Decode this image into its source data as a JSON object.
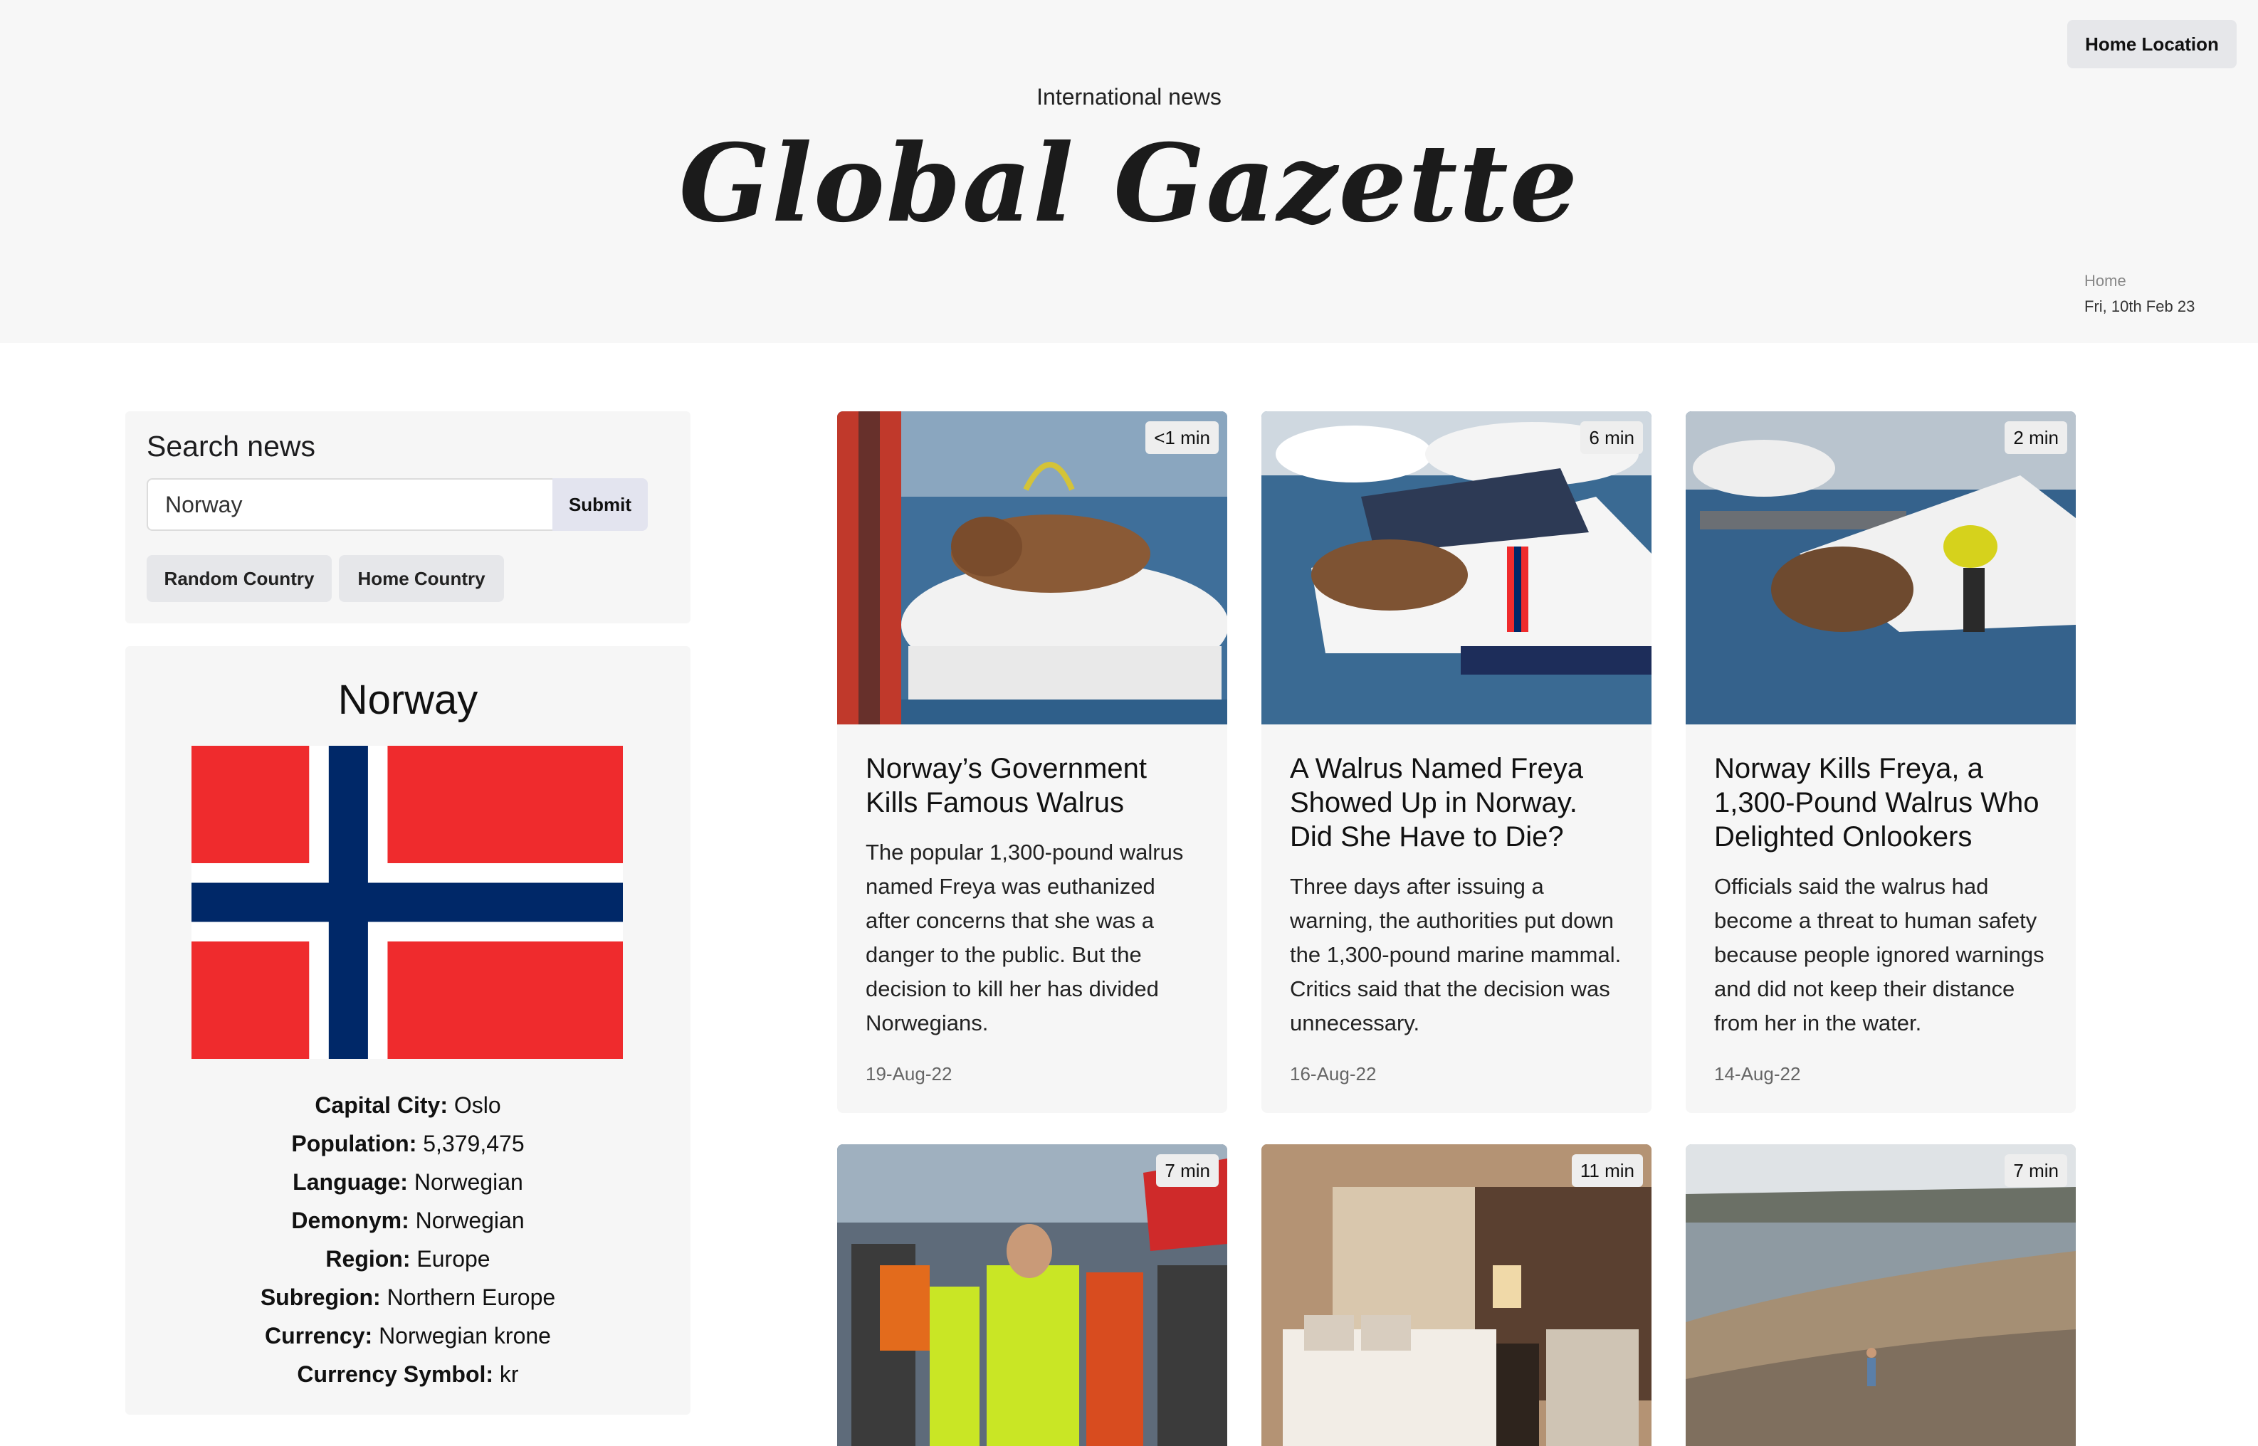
{
  "header": {
    "home_location_button": "Home Location",
    "kicker": "International news",
    "masthead": "Global Gazette",
    "breadcrumb": "Home",
    "date": "Fri, 10th Feb 23"
  },
  "search": {
    "title": "Search news",
    "input_value": "Norway",
    "submit_label": "Submit",
    "random_country_label": "Random Country",
    "home_country_label": "Home Country"
  },
  "country": {
    "name": "Norway",
    "flag_colors": {
      "red": "#ef2b2d",
      "blue": "#002868",
      "white": "#ffffff"
    },
    "facts": [
      {
        "label": "Capital City:",
        "value": "Oslo"
      },
      {
        "label": "Population:",
        "value": "5,379,475"
      },
      {
        "label": "Language:",
        "value": "Norwegian"
      },
      {
        "label": "Demonym:",
        "value": "Norwegian"
      },
      {
        "label": "Region:",
        "value": "Europe"
      },
      {
        "label": "Subregion:",
        "value": "Northern Europe"
      },
      {
        "label": "Currency:",
        "value": "Norwegian krone"
      },
      {
        "label": "Currency Symbol:",
        "value": "kr"
      }
    ]
  },
  "articles": [
    {
      "read_time": "<1 min",
      "title": "Norway’s Government Kills Famous Walrus",
      "description": "The popular 1,300-pound walrus named Freya was euthanized after concerns that she was a danger to the public. But the decision to kill her has divided Norwegians.",
      "date": "19-Aug-22",
      "image": "walrus-on-boat-photo"
    },
    {
      "read_time": "6 min",
      "title": "A Walrus Named Freya Showed Up in Norway. Did She Have to Die?",
      "description": "Three days after issuing a warning, the authorities put down the 1,300-pound marine mammal. Critics said that the decision was unnecessary.",
      "date": "16-Aug-22",
      "image": "walrus-beside-boat-photo"
    },
    {
      "read_time": "2 min",
      "title": "Norway Kills Freya, a 1,300-Pound Walrus Who Delighted Onlookers",
      "description": "Officials said the walrus had become a threat to human safety because people ignored warnings and did not keep their distance from her in the water.",
      "date": "14-Aug-22",
      "image": "walrus-in-water-photo"
    },
    {
      "read_time": "7 min",
      "image": "protest-march-photo"
    },
    {
      "read_time": "11 min",
      "image": "hotel-room-photo"
    },
    {
      "read_time": "7 min",
      "image": "rocky-shore-photo"
    }
  ]
}
